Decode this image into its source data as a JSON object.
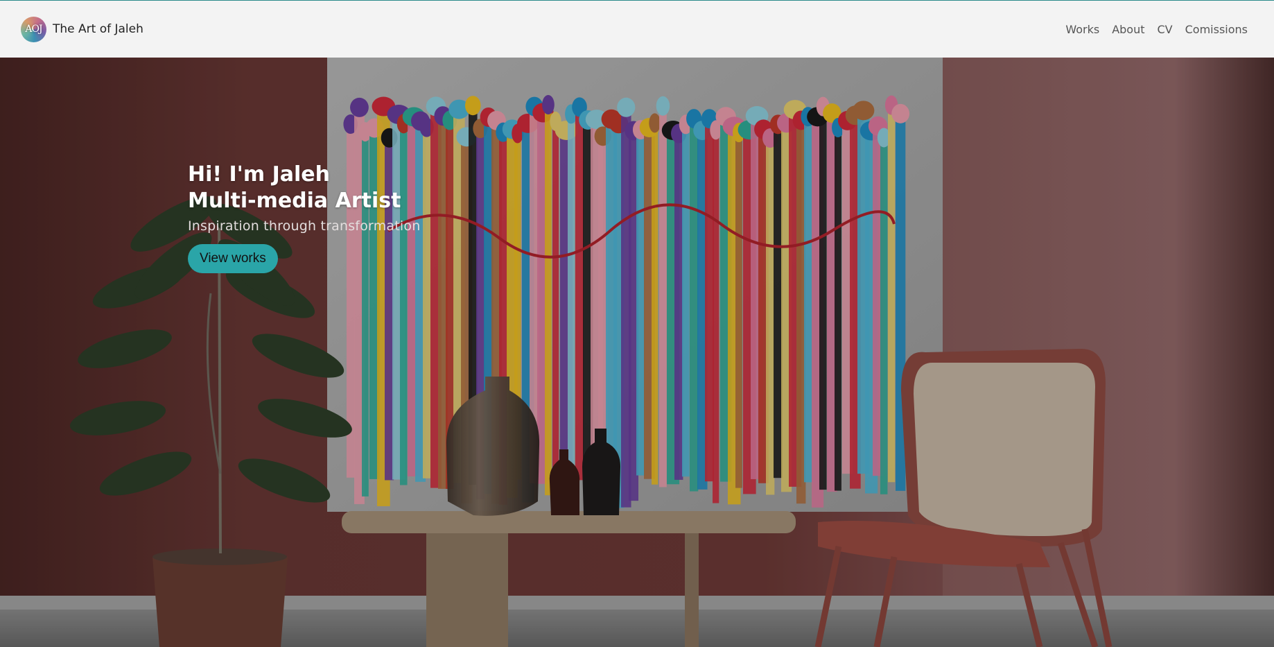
{
  "header": {
    "logo_text": "AOJ",
    "site_title": "The Art of Jaleh",
    "nav": [
      "Works",
      "About",
      "CV",
      "Comissions"
    ]
  },
  "hero": {
    "title_line1": "Hi! I'm Jaleh",
    "title_line2": "Multi-media Artist",
    "subtitle": "Inspiration through transformation",
    "cta_label": "View works"
  },
  "colors": {
    "accent": "#2aa5a8",
    "header_bg": "#f3f3f3",
    "wall": "#6e3a37",
    "header_border": "#2a8a8a"
  }
}
